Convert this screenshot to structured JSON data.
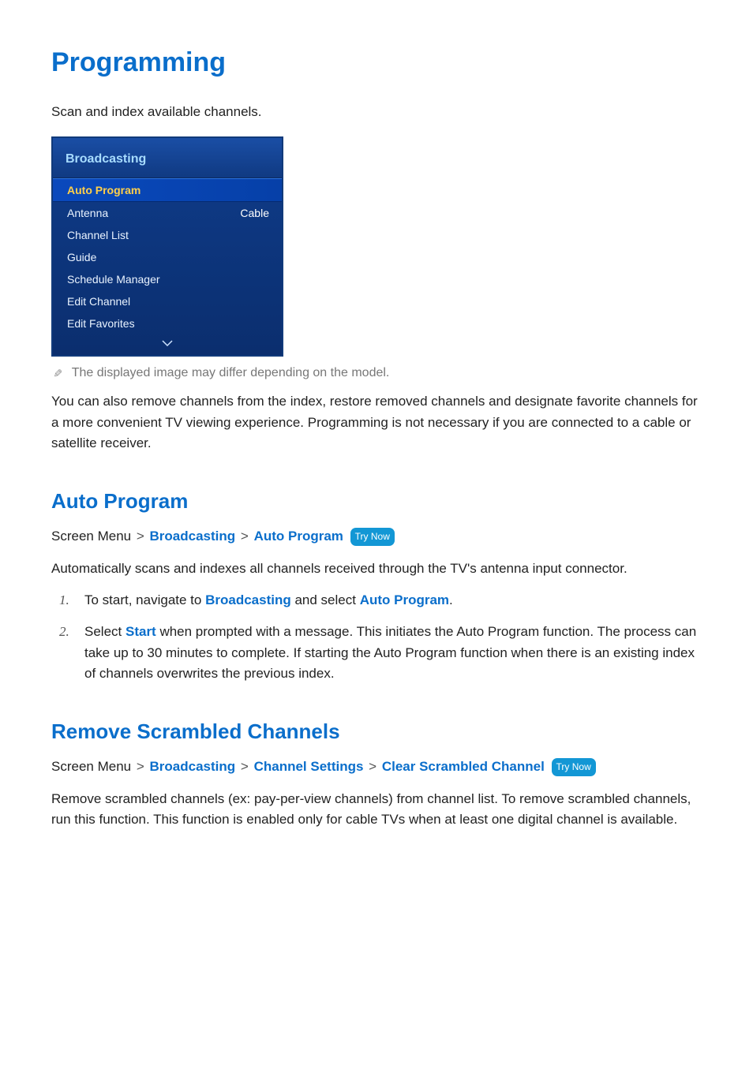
{
  "title": "Programming",
  "intro": "Scan and index available channels.",
  "menu": {
    "header": "Broadcasting",
    "rows": [
      {
        "label": "Auto Program",
        "value": "",
        "selected": true
      },
      {
        "label": "Antenna",
        "value": "Cable",
        "selected": false
      },
      {
        "label": "Channel List",
        "value": "",
        "selected": false
      },
      {
        "label": "Guide",
        "value": "",
        "selected": false
      },
      {
        "label": "Schedule Manager",
        "value": "",
        "selected": false
      },
      {
        "label": "Edit Channel",
        "value": "",
        "selected": false
      },
      {
        "label": "Edit Favorites",
        "value": "",
        "selected": false
      }
    ]
  },
  "note": "The displayed image may differ depending on the model.",
  "after_menu_para": "You can also remove channels from the index, restore removed channels and designate favorite channels for a more convenient TV viewing experience. Programming is not necessary if you are connected to a cable or satellite receiver.",
  "auto_program": {
    "heading": "Auto Program",
    "path_prefix": "Screen Menu",
    "broadcasting": "Broadcasting",
    "auto_program": "Auto Program",
    "try_now": "Try Now",
    "desc": "Automatically scans and indexes all channels received through the TV's antenna input connector.",
    "step1_pre": "To start, navigate to ",
    "step1_broadcasting": "Broadcasting",
    "step1_mid": " and select ",
    "step1_auto": "Auto Program",
    "step1_post": ".",
    "step2_pre": "Select ",
    "step2_start": "Start",
    "step2_post": " when prompted with a message. This initiates the Auto Program function. The process can take up to 30 minutes to complete. If starting the Auto Program function when there is an existing index of channels overwrites the previous index."
  },
  "remove_scrambled": {
    "heading": "Remove Scrambled Channels",
    "path_prefix": "Screen Menu",
    "p1": "Broadcasting",
    "p2": "Channel Settings",
    "p3": "Clear Scrambled Channel",
    "try_now": "Try Now",
    "desc": "Remove scrambled channels (ex: pay-per-view channels) from channel list. To remove scrambled channels, run this function. This function is enabled only for cable TVs when at least one digital channel is available."
  },
  "markers": {
    "n1": "1.",
    "n2": "2.",
    "sep": ">"
  }
}
